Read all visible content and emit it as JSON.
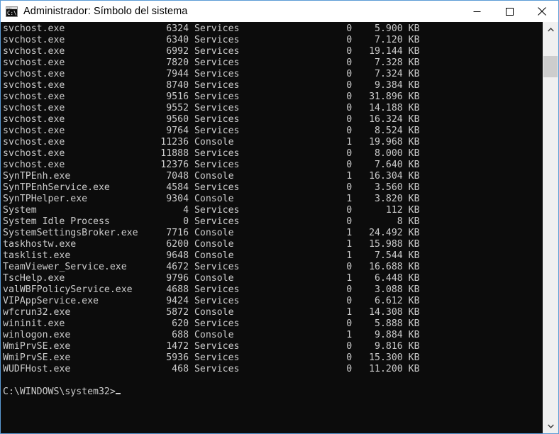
{
  "window": {
    "title": "Administrador: Símbolo del sistema",
    "icon": "command-prompt-icon",
    "controls": {
      "minimize": "minimize-icon",
      "maximize": "maximize-icon",
      "close": "close-icon"
    },
    "accent_border": "#5b9bd5",
    "console_bg": "#0c0c0c",
    "console_fg": "#cccccc"
  },
  "console": {
    "rows": [
      {
        "image_name": "svchost.exe",
        "pid": "6324",
        "session_name": "Services",
        "session_num": "0",
        "mem_usage": "5.900 KB"
      },
      {
        "image_name": "svchost.exe",
        "pid": "6340",
        "session_name": "Services",
        "session_num": "0",
        "mem_usage": "7.120 KB"
      },
      {
        "image_name": "svchost.exe",
        "pid": "6992",
        "session_name": "Services",
        "session_num": "0",
        "mem_usage": "19.144 KB"
      },
      {
        "image_name": "svchost.exe",
        "pid": "7820",
        "session_name": "Services",
        "session_num": "0",
        "mem_usage": "7.328 KB"
      },
      {
        "image_name": "svchost.exe",
        "pid": "7944",
        "session_name": "Services",
        "session_num": "0",
        "mem_usage": "7.324 KB"
      },
      {
        "image_name": "svchost.exe",
        "pid": "8740",
        "session_name": "Services",
        "session_num": "0",
        "mem_usage": "9.384 KB"
      },
      {
        "image_name": "svchost.exe",
        "pid": "9516",
        "session_name": "Services",
        "session_num": "0",
        "mem_usage": "31.896 KB"
      },
      {
        "image_name": "svchost.exe",
        "pid": "9552",
        "session_name": "Services",
        "session_num": "0",
        "mem_usage": "14.188 KB"
      },
      {
        "image_name": "svchost.exe",
        "pid": "9560",
        "session_name": "Services",
        "session_num": "0",
        "mem_usage": "16.324 KB"
      },
      {
        "image_name": "svchost.exe",
        "pid": "9764",
        "session_name": "Services",
        "session_num": "0",
        "mem_usage": "8.524 KB"
      },
      {
        "image_name": "svchost.exe",
        "pid": "11236",
        "session_name": "Console",
        "session_num": "1",
        "mem_usage": "19.968 KB"
      },
      {
        "image_name": "svchost.exe",
        "pid": "11888",
        "session_name": "Services",
        "session_num": "0",
        "mem_usage": "8.000 KB"
      },
      {
        "image_name": "svchost.exe",
        "pid": "12376",
        "session_name": "Services",
        "session_num": "0",
        "mem_usage": "7.640 KB"
      },
      {
        "image_name": "SynTPEnh.exe",
        "pid": "7048",
        "session_name": "Console",
        "session_num": "1",
        "mem_usage": "16.304 KB"
      },
      {
        "image_name": "SynTPEnhService.exe",
        "pid": "4584",
        "session_name": "Services",
        "session_num": "0",
        "mem_usage": "3.560 KB"
      },
      {
        "image_name": "SynTPHelper.exe",
        "pid": "9304",
        "session_name": "Console",
        "session_num": "1",
        "mem_usage": "3.820 KB"
      },
      {
        "image_name": "System",
        "pid": "4",
        "session_name": "Services",
        "session_num": "0",
        "mem_usage": "112 KB"
      },
      {
        "image_name": "System Idle Process",
        "pid": "0",
        "session_name": "Services",
        "session_num": "0",
        "mem_usage": "8 KB"
      },
      {
        "image_name": "SystemSettingsBroker.exe",
        "pid": "7716",
        "session_name": "Console",
        "session_num": "1",
        "mem_usage": "24.492 KB"
      },
      {
        "image_name": "taskhostw.exe",
        "pid": "6200",
        "session_name": "Console",
        "session_num": "1",
        "mem_usage": "15.988 KB"
      },
      {
        "image_name": "tasklist.exe",
        "pid": "9648",
        "session_name": "Console",
        "session_num": "1",
        "mem_usage": "7.544 KB"
      },
      {
        "image_name": "TeamViewer_Service.exe",
        "pid": "4672",
        "session_name": "Services",
        "session_num": "0",
        "mem_usage": "16.688 KB"
      },
      {
        "image_name": "TscHelp.exe",
        "pid": "9796",
        "session_name": "Console",
        "session_num": "1",
        "mem_usage": "6.448 KB"
      },
      {
        "image_name": "valWBFPolicyService.exe",
        "pid": "4688",
        "session_name": "Services",
        "session_num": "0",
        "mem_usage": "3.088 KB"
      },
      {
        "image_name": "VIPAppService.exe",
        "pid": "9424",
        "session_name": "Services",
        "session_num": "0",
        "mem_usage": "6.612 KB"
      },
      {
        "image_name": "wfcrun32.exe",
        "pid": "5872",
        "session_name": "Console",
        "session_num": "1",
        "mem_usage": "14.308 KB"
      },
      {
        "image_name": "wininit.exe",
        "pid": "620",
        "session_name": "Services",
        "session_num": "0",
        "mem_usage": "5.888 KB"
      },
      {
        "image_name": "winlogon.exe",
        "pid": "688",
        "session_name": "Console",
        "session_num": "1",
        "mem_usage": "9.884 KB"
      },
      {
        "image_name": "WmiPrvSE.exe",
        "pid": "1472",
        "session_name": "Services",
        "session_num": "0",
        "mem_usage": "9.816 KB"
      },
      {
        "image_name": "WmiPrvSE.exe",
        "pid": "5936",
        "session_name": "Services",
        "session_num": "0",
        "mem_usage": "15.300 KB"
      },
      {
        "image_name": "WUDFHost.exe",
        "pid": "468",
        "session_name": "Services",
        "session_num": "0",
        "mem_usage": "11.200 KB"
      }
    ],
    "blank_line": "",
    "prompt": "C:\\WINDOWS\\system32>",
    "column_widths": {
      "image_name": 25,
      "pid": 8,
      "session_name": 17,
      "session_num": 11,
      "mem_usage": 12
    }
  },
  "scrollbar": {
    "up_arrow": "chevron-up-icon",
    "down_arrow": "chevron-down-icon",
    "thumb": "scrollbar-thumb"
  }
}
